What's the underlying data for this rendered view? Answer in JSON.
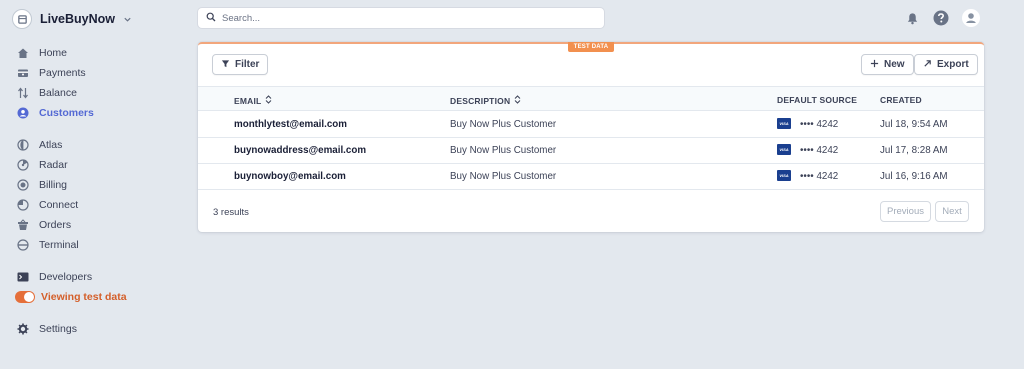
{
  "brand": {
    "name": "LiveBuyNow"
  },
  "sidebar": {
    "items": [
      {
        "label": "Home",
        "icon": "home-icon"
      },
      {
        "label": "Payments",
        "icon": "payments-icon"
      },
      {
        "label": "Balance",
        "icon": "balance-icon"
      },
      {
        "label": "Customers",
        "icon": "customers-icon",
        "active": true
      },
      {
        "label": "Atlas",
        "icon": "atlas-icon"
      },
      {
        "label": "Radar",
        "icon": "radar-icon"
      },
      {
        "label": "Billing",
        "icon": "billing-icon"
      },
      {
        "label": "Connect",
        "icon": "connect-icon"
      },
      {
        "label": "Orders",
        "icon": "orders-icon"
      },
      {
        "label": "Terminal",
        "icon": "terminal-icon"
      },
      {
        "label": "Developers",
        "icon": "developers-icon"
      },
      {
        "label": "Viewing test data",
        "icon": "toggle-icon"
      },
      {
        "label": "Settings",
        "icon": "gear-icon"
      }
    ]
  },
  "header": {
    "search_placeholder": "Search...",
    "icons": [
      "bell-icon",
      "help-icon",
      "user-icon"
    ]
  },
  "main": {
    "badge": "TEST DATA",
    "filter_label": "Filter",
    "new_label": "New",
    "export_label": "Export",
    "columns": {
      "email": "EMAIL",
      "description": "DESCRIPTION",
      "source": "DEFAULT SOURCE",
      "created": "CREATED"
    },
    "rows": [
      {
        "email": "monthlytest@email.com",
        "description": "Buy Now Plus Customer",
        "card_brand": "VISA",
        "card": "•••• 4242",
        "created": "Jul 18, 9:54 AM"
      },
      {
        "email": "buynowaddress@email.com",
        "description": "Buy Now Plus Customer",
        "card_brand": "VISA",
        "card": "•••• 4242",
        "created": "Jul 17, 8:28 AM"
      },
      {
        "email": "buynowboy@email.com",
        "description": "Buy Now Plus Customer",
        "card_brand": "VISA",
        "card": "•••• 4242",
        "created": "Jul 16, 9:16 AM"
      }
    ],
    "results": "3 results",
    "previous_label": "Previous",
    "next_label": "Next"
  },
  "colors": {
    "accent": "#5469d4",
    "test": "#e56f3a",
    "visa": "#1a3f8f"
  }
}
